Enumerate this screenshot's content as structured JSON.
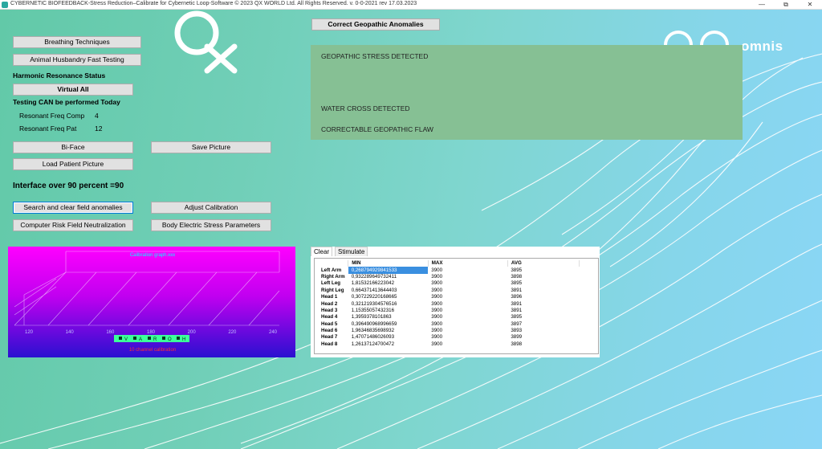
{
  "titlebar": {
    "title": "CYBERNETIC BIOFEEDBACK-Stress Reduction–Calibrate for Cybernetic Loop-Software © 2023  QX WORLD Ltd. All Rights Reserved. v. 0-0-2021 rev 17.03.2023",
    "minimize": "—",
    "maximize": "⧉",
    "close": "✕"
  },
  "left": {
    "breathing": "Breathing Techniques",
    "animal": "Animal Husbandry Fast Testing",
    "harmonic_status": "Harmonic Resonance Status",
    "virtual_all": "Virtual All",
    "testing_can": "Testing CAN be performed Today",
    "res_comp_label": "Resonant Freq Comp",
    "res_comp_value": "4",
    "res_pat_label": "Resonant Freq Pat",
    "res_pat_value": "12",
    "biface": "Bi-Face",
    "save_picture": "Save Picture",
    "load_patient": "Load Patient Picture",
    "interface_text": "Interface over 90 percent =90",
    "search_clear": "Search and clear field anomalies",
    "adjust_calibration": "Adjust Calibration",
    "computer_risk": "Computer Risk Field Neutralization",
    "body_electric": "Body Electric Stress Parameters"
  },
  "top": {
    "correct_geo": "Correct Geopathic Anomalies"
  },
  "panel": {
    "line1": "GEOPATHIC STRESS DETECTED",
    "line2": "WATER CROSS DETECTED",
    "line3": "CORRECTABLE GEOPATHIC FLAW"
  },
  "logo": {
    "text": "omnis"
  },
  "chart_data": {
    "type": "area",
    "title": "Calibration graph.xxx",
    "xlabel": "10 channel calibration",
    "x_ticks": [
      "120",
      "140",
      "160",
      "180",
      "200",
      "220",
      "240"
    ],
    "legend": [
      "V",
      "A",
      "R",
      "O",
      "H"
    ],
    "colors": {
      "top": "#ff00ff",
      "bottom": "#2a10d0",
      "accent": "#00ffff"
    }
  },
  "tabs": {
    "clear": "Clear",
    "stimulate": "Stimulate"
  },
  "table": {
    "headers": [
      "",
      "MIN",
      "MAX",
      "AVG"
    ],
    "rows": [
      [
        "Left Arm",
        "0,268794929841533",
        "3900",
        "3895"
      ],
      [
        "Right Arm",
        "0,932289649732411",
        "3900",
        "3898"
      ],
      [
        "Left Leg",
        "1,81532166223042",
        "3900",
        "3895"
      ],
      [
        "Right Leg",
        "0,664371413644403",
        "3900",
        "3891"
      ],
      [
        "Head 1",
        "0,307229220168665",
        "3900",
        "3896"
      ],
      [
        "Head 2",
        "0,321219304576516",
        "3900",
        "3891"
      ],
      [
        "Head 3",
        "1,15355057432316",
        "3900",
        "3891"
      ],
      [
        "Head 4",
        "1,3959378101863",
        "3900",
        "3895"
      ],
      [
        "Head 5",
        "0,396490968996659",
        "3900",
        "3897"
      ],
      [
        "Head 6",
        "1,96346835698932",
        "3900",
        "3893"
      ],
      [
        "Head 7",
        "1,47071486026093",
        "3900",
        "3899"
      ],
      [
        "Head 8",
        "1,26137124700472",
        "3900",
        "3898"
      ]
    ]
  }
}
